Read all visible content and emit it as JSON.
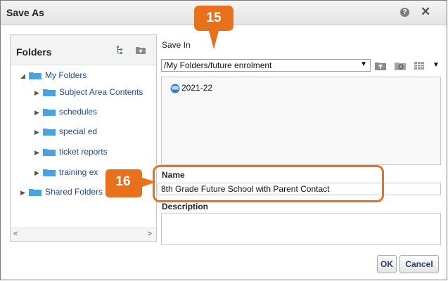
{
  "dialog": {
    "title": "Save As",
    "help_icon": "?",
    "close_icon": "✕"
  },
  "folders": {
    "title": "Folders",
    "items": [
      {
        "label": "My Folders",
        "expanded": true
      },
      {
        "label": "Subject Area Contents"
      },
      {
        "label": "schedules"
      },
      {
        "label": "special ed"
      },
      {
        "label": "ticket reports"
      },
      {
        "label": "training ex"
      },
      {
        "label": "Shared Folders"
      }
    ]
  },
  "save_in": {
    "label": "Save In",
    "path": "/My Folders/future enrolment",
    "items": [
      {
        "label": "2021-22",
        "icon": "globe-icon"
      }
    ]
  },
  "name": {
    "label": "Name",
    "value": "8th Grade Future School with Parent Contact"
  },
  "description": {
    "label": "Description",
    "value": ""
  },
  "buttons": {
    "ok": "OK",
    "cancel": "Cancel"
  },
  "callouts": {
    "step15": "15",
    "step16": "16",
    "color": "#e8711e"
  }
}
